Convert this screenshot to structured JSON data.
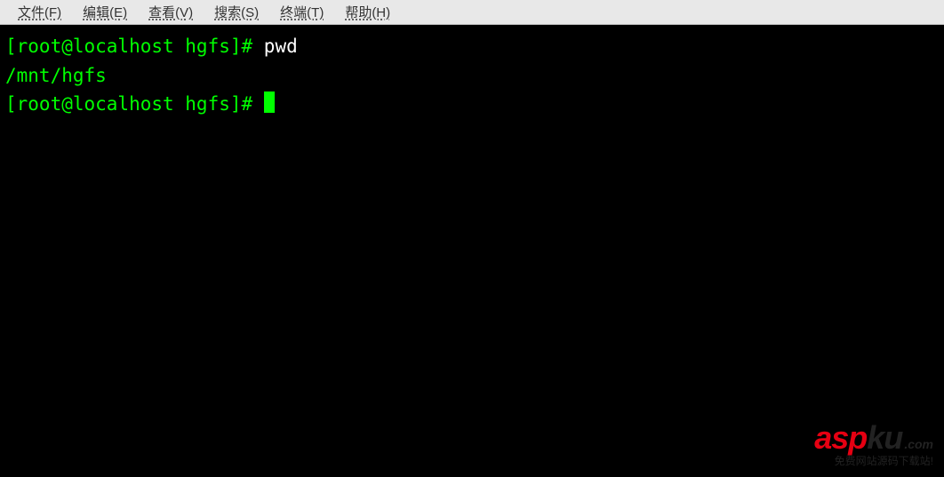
{
  "menubar": {
    "items": [
      {
        "label": "文件(F)"
      },
      {
        "label": "编辑(E)"
      },
      {
        "label": "查看(V)"
      },
      {
        "label": "搜索(S)"
      },
      {
        "label": "终端(T)"
      },
      {
        "label": "帮助(H)"
      }
    ]
  },
  "terminal": {
    "lines": [
      {
        "prompt": "[root@localhost hgfs]# ",
        "command": "pwd"
      },
      {
        "output": "/mnt/hgfs"
      },
      {
        "prompt": "[root@localhost hgfs]# ",
        "command": "",
        "cursor": true
      }
    ]
  },
  "watermark": {
    "asp": "asp",
    "ku": "ku",
    "com": ".com",
    "sub": "免费网站源码下载站!"
  }
}
